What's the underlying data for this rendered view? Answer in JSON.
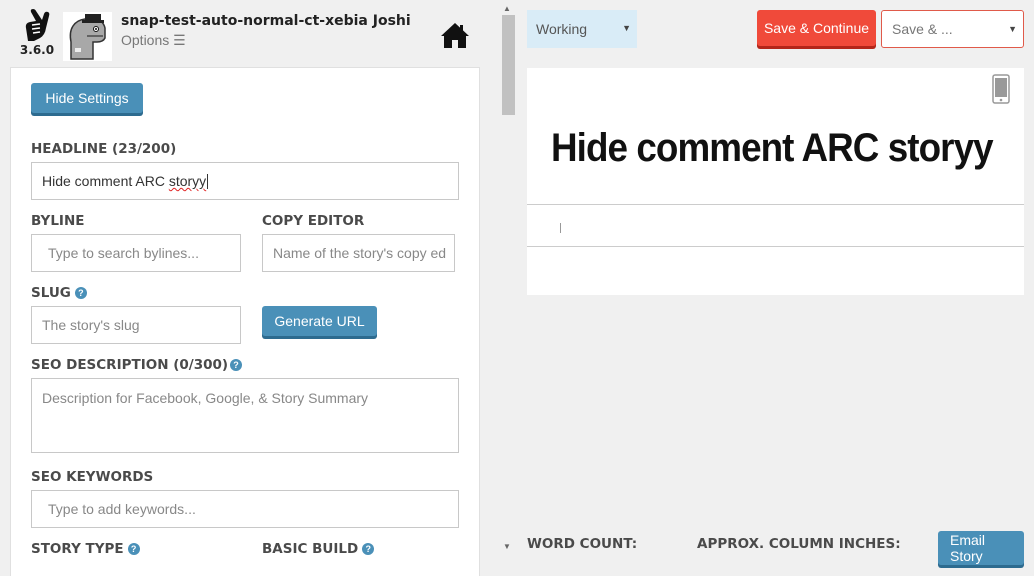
{
  "header": {
    "version": "3.6.0",
    "user_name": "snap-test-auto-normal-ct-xebia Joshi",
    "options_label": "Options ☰"
  },
  "settings": {
    "hide_settings_label": "Hide Settings",
    "headline": {
      "label": "HEADLINE (23/200)",
      "value_word1": "Hide comment ARC ",
      "value_word2": "storyy"
    },
    "byline": {
      "label": "BYLINE",
      "placeholder": "Type to search bylines..."
    },
    "copy_editor": {
      "label": "COPY EDITOR",
      "placeholder": "Name of the story's copy ed"
    },
    "slug": {
      "label": "SLUG",
      "placeholder": "The story's slug"
    },
    "generate_url_label": "Generate URL",
    "seo_description": {
      "label": "SEO DESCRIPTION (0/300)",
      "placeholder": "Description for Facebook, Google, & Story Summary"
    },
    "seo_keywords": {
      "label": "SEO KEYWORDS",
      "placeholder": "Type to add keywords..."
    },
    "story_type": {
      "label": "STORY TYPE"
    },
    "basic_build": {
      "label": "BASIC BUILD"
    },
    "help_glyph": "?"
  },
  "toolbar": {
    "status_value": "Working",
    "save_continue_label": "Save & Continue",
    "save_menu_value": "Save & ..."
  },
  "preview": {
    "headline": "Hide comment ARC storyy"
  },
  "footer": {
    "word_count_label": "WORD COUNT:",
    "column_inches_label": "APPROX. COLUMN INCHES:",
    "email_story_label": "Email Story"
  },
  "colors": {
    "accent_blue": "#4a90b8",
    "save_red": "#f04a3a",
    "status_bg": "#d9ecf7"
  }
}
